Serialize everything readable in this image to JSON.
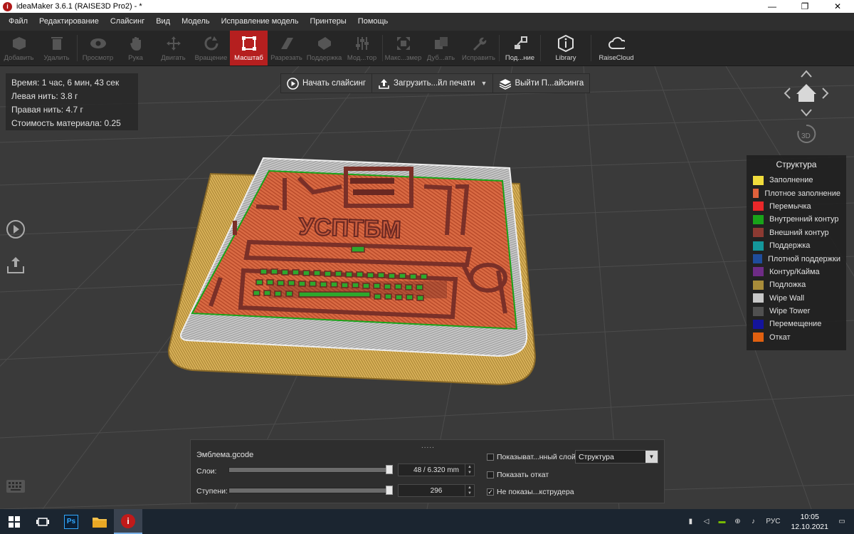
{
  "window": {
    "title": "ideaMaker 3.6.1 (RAISE3D Pro2) - *",
    "app_icon_letter": "i"
  },
  "menu": [
    "Файл",
    "Редактирование",
    "Слайсинг",
    "Вид",
    "Модель",
    "Исправление модель",
    "Принтеры",
    "Помощь"
  ],
  "toolbar": {
    "add": "Добавить",
    "remove": "Удалить",
    "view": "Просмотр",
    "hand": "Рука",
    "move": "Двигать",
    "rotate": "Вращение",
    "scale": "Масштаб",
    "cut": "Разрезать",
    "support": "Поддержка",
    "modifier": "Мод...тор",
    "maxsize": "Макс...змер",
    "duplicate": "Дуб...ать",
    "repair": "Исправить",
    "connect": "Под...ние",
    "library": "Library",
    "raisecloud": "RaiseCloud"
  },
  "stats": {
    "time": "Время: 1 час, 6 мин, 43 сек",
    "left": "Левая нить: 3.8 г",
    "right": "Правая нить: 4.7 г",
    "cost": "Стоимость материала: 0.25"
  },
  "slicebar": {
    "start": "Начать слайсинг",
    "upload": "Загрузить...йл печати",
    "exit": "Выйти П...айсинга"
  },
  "model_text": "УСПТБМ",
  "legend": {
    "title": "Структура",
    "items": [
      {
        "label": "Заполнение",
        "color": "#f0dc3c"
      },
      {
        "label": "Плотное заполнение",
        "color": "#e0623c"
      },
      {
        "label": "Перемычка",
        "color": "#e8282a"
      },
      {
        "label": "Внутренний контур",
        "color": "#19a319"
      },
      {
        "label": "Внешний контур",
        "color": "#8c3a32"
      },
      {
        "label": "Поддержка",
        "color": "#14979b"
      },
      {
        "label": "Плотной поддержки",
        "color": "#1f4d9c"
      },
      {
        "label": "Контур/Кайма",
        "color": "#6e2c86"
      },
      {
        "label": "Подложка",
        "color": "#a88c3a"
      },
      {
        "label": "Wipe Wall",
        "color": "#c8c8c8"
      },
      {
        "label": "Wipe Tower",
        "color": "#505050"
      },
      {
        "label": "Перемещение",
        "color": "#14149c"
      },
      {
        "label": "Откат",
        "color": "#e06010"
      }
    ]
  },
  "bottom": {
    "file": "Эмблема.gcode",
    "layers_label": "Слои:",
    "layers_value": "48 / 6.320 mm",
    "layers_fraction": 1.0,
    "steps_label": "Ступени:",
    "steps_value": "296",
    "steps_fraction": 1.0,
    "show_layer": "Показыват...нный слой",
    "show_layer_checked": false,
    "show_retract": "Показать откат",
    "show_retract_checked": false,
    "hide_extruder": "Не показы...кструдера",
    "hide_extruder_checked": true,
    "mode_select": "Структура",
    "check_mark": "✓",
    "grip": "....."
  },
  "nav": {
    "label_3d": "3D"
  },
  "taskbar": {
    "lang": "РУС",
    "time": "10:05",
    "date": "12.10.2021",
    "ps_label": "Ps"
  }
}
